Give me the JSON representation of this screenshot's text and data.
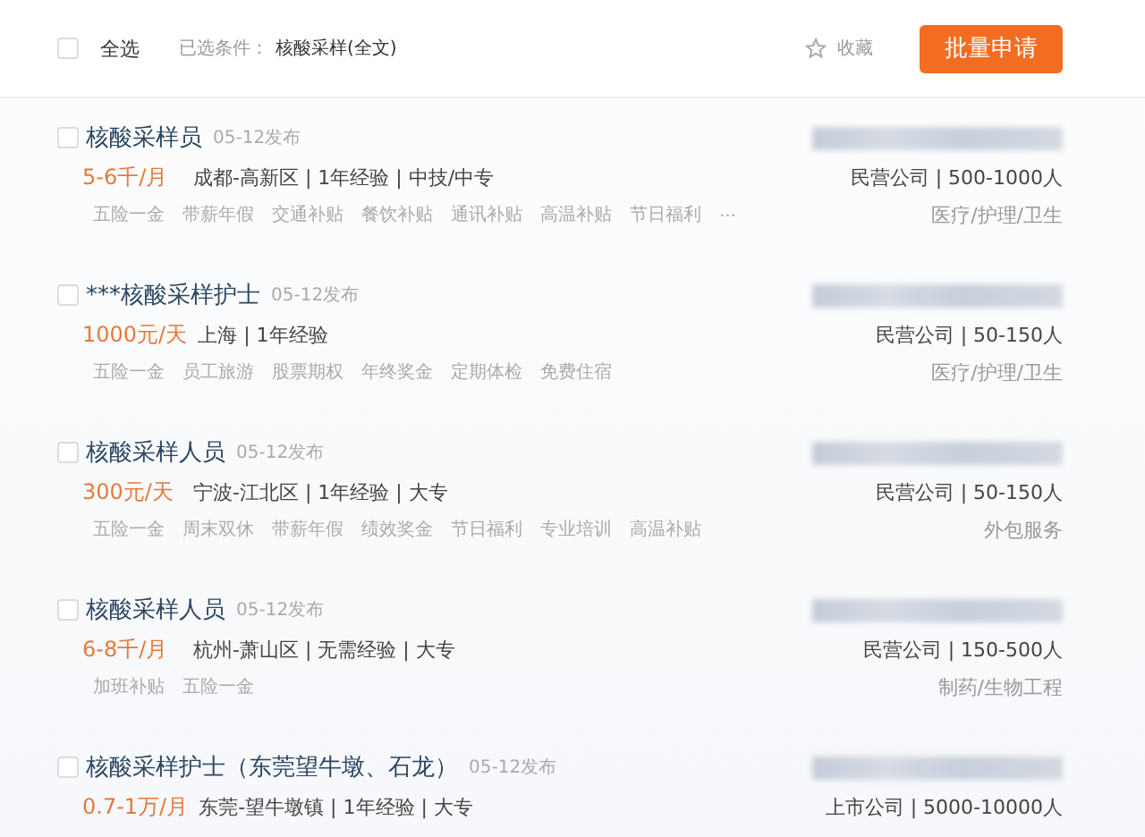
{
  "toolbar": {
    "select_all": {
      "label": "全选",
      "checked": false
    },
    "filter_label": "已选条件：",
    "filter_value": "核酸采样(全文)",
    "favorite": {
      "label": "收藏"
    },
    "apply_button": "批量申请"
  },
  "jobs": [
    {
      "checked": false,
      "title": "核酸采样员",
      "date": "05-12发布",
      "salary": "5-6千/月",
      "details": "成都-高新区 | 1年经验 | 中技/中专",
      "company_info": "民营公司 | 500-1000人",
      "industry": "医疗/护理/卫生",
      "tags": [
        "五险一金",
        "带薪年假",
        "交通补贴",
        "餐饮补贴",
        "通讯补贴",
        "高温补贴",
        "节日福利"
      ],
      "more": "..."
    },
    {
      "checked": false,
      "title": "***核酸采样护士",
      "date": "05-12发布",
      "salary": "1000元/天",
      "details": "上海 | 1年经验",
      "company_info": "民营公司 | 50-150人",
      "industry": "医疗/护理/卫生",
      "tags": [
        "五险一金",
        "员工旅游",
        "股票期权",
        "年终奖金",
        "定期体检",
        "免费住宿"
      ]
    },
    {
      "checked": false,
      "title": "核酸采样人员",
      "date": "05-12发布",
      "salary": "300元/天",
      "details": "宁波-江北区 | 1年经验 | 大专",
      "company_info": "民营公司 | 50-150人",
      "industry": "外包服务",
      "tags": [
        "五险一金",
        "周末双休",
        "带薪年假",
        "绩效奖金",
        "节日福利",
        "专业培训",
        "高温补贴"
      ]
    },
    {
      "checked": false,
      "title": "核酸采样人员",
      "date": "05-12发布",
      "salary": "6-8千/月",
      "details": "杭州-萧山区 | 无需经验 | 大专",
      "company_info": "民营公司 | 150-500人",
      "industry": "制药/生物工程",
      "tags": [
        "加班补贴",
        "五险一金"
      ]
    },
    {
      "checked": false,
      "title": "核酸采样护士（东莞望牛墩、石龙）",
      "date": "05-12发布",
      "salary": "0.7-1万/月",
      "details": "东莞-望牛墩镇 | 1年经验 | 大专",
      "company_info": "上市公司 | 5000-10000人"
    }
  ]
}
